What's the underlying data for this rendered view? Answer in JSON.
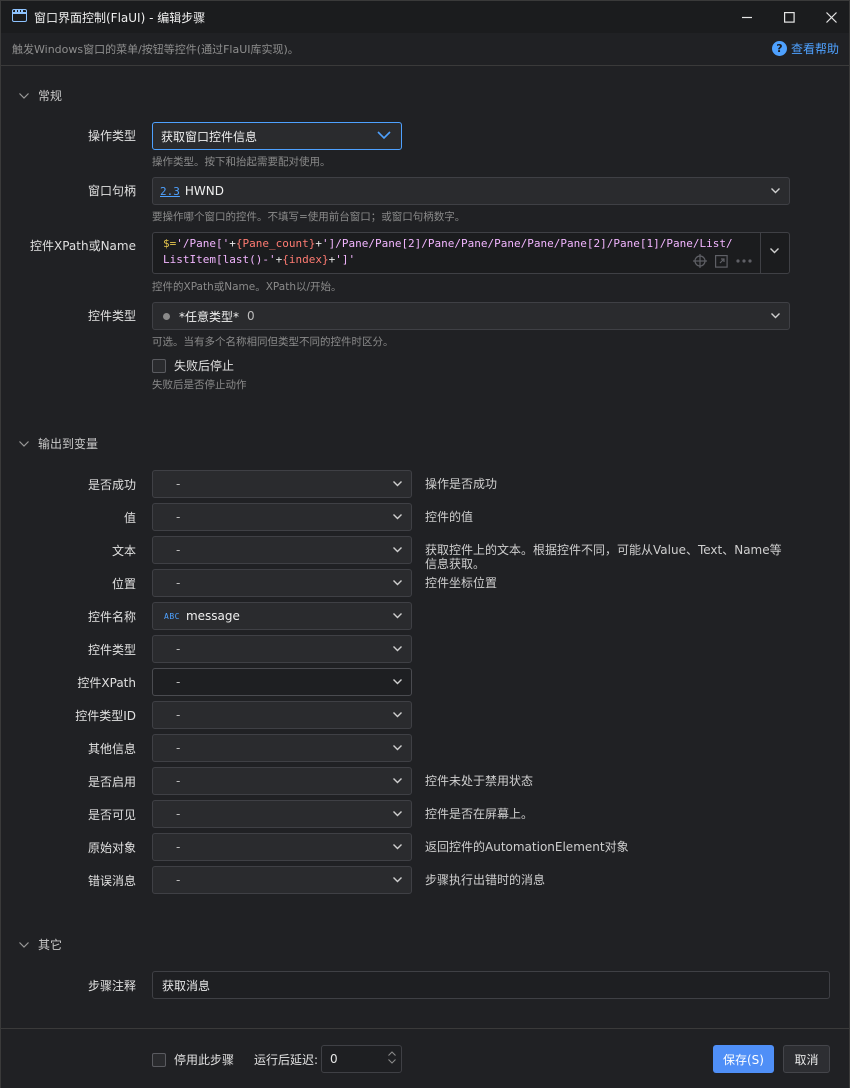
{
  "window": {
    "title": "窗口界面控制(FlaUI)  -  编辑步骤",
    "description": "触发Windows窗口的菜单/按钮等控件(通过FlaUI库实现)。",
    "help_label": "查看帮助",
    "help_icon": "?"
  },
  "sections": {
    "general": "常规",
    "output": "输出到变量",
    "other": "其它"
  },
  "general": {
    "operation_type": {
      "label": "操作类型",
      "value": "获取窗口控件信息",
      "hint": "操作类型。按下和抬起需要配对使用。"
    },
    "window_handle": {
      "label": "窗口句柄",
      "type_tag": "2.3",
      "value": "HWND",
      "hint": "要操作哪个窗口的控件。不填写=使用前台窗口；或窗口句柄数字。"
    },
    "xpath": {
      "label": "控件XPath或Name",
      "hint": "控件的XPath或Name。XPath以/开始。",
      "code": {
        "prefix": "$=",
        "s1": "'/Pane['",
        "v1": "{Pane_count}",
        "s2": "']/Pane/Pane[2]/Pane/Pane/Pane/Pane/Pane[2]/Pane[1]/Pane/List/ListItem[last()-'",
        "v2": "{index}",
        "s3": "']'"
      }
    },
    "control_type": {
      "label": "控件类型",
      "value": "*任意类型*",
      "count": "0",
      "hint": "可选。当有多个名称相同但类型不同的控件时区分。"
    },
    "stop_on_fail": {
      "label": "失败后停止",
      "hint": "失败后是否停止动作",
      "checked": false
    }
  },
  "outputs": [
    {
      "label": "是否成功",
      "value": "-",
      "desc": "操作是否成功"
    },
    {
      "label": "值",
      "value": "-",
      "desc": "控件的值"
    },
    {
      "label": "文本",
      "value": "-",
      "desc": "获取控件上的文本。根据控件不同，可能从Value、Text、Name等信息获取。"
    },
    {
      "label": "位置",
      "value": "-",
      "desc": "控件坐标位置"
    },
    {
      "label": "控件名称",
      "value": "message",
      "type_tag": "ABC",
      "desc": ""
    },
    {
      "label": "控件类型",
      "value": "-",
      "desc": ""
    },
    {
      "label": "控件XPath",
      "value": "-",
      "desc": ""
    },
    {
      "label": "控件类型ID",
      "value": "-",
      "desc": ""
    },
    {
      "label": "其他信息",
      "value": "-",
      "desc": ""
    },
    {
      "label": "是否启用",
      "value": "-",
      "desc": "控件未处于禁用状态"
    },
    {
      "label": "是否可见",
      "value": "-",
      "desc": "控件是否在屏幕上。"
    },
    {
      "label": "原始对象",
      "value": "-",
      "desc": "返回控件的AutomationElement对象"
    },
    {
      "label": "错误消息",
      "value": "-",
      "desc": "步骤执行出错时的消息"
    }
  ],
  "other": {
    "note_label": "步骤注释",
    "note_value": "获取消息"
  },
  "footer": {
    "disable_label": "停用此步骤",
    "delay_label": "运行后延迟:",
    "delay_value": "0",
    "save_label": "保存(S)",
    "cancel_label": "取消"
  },
  "colors": {
    "accent": "#4ea1ff",
    "primary_button": "#4f8ff7",
    "background": "#202124"
  }
}
